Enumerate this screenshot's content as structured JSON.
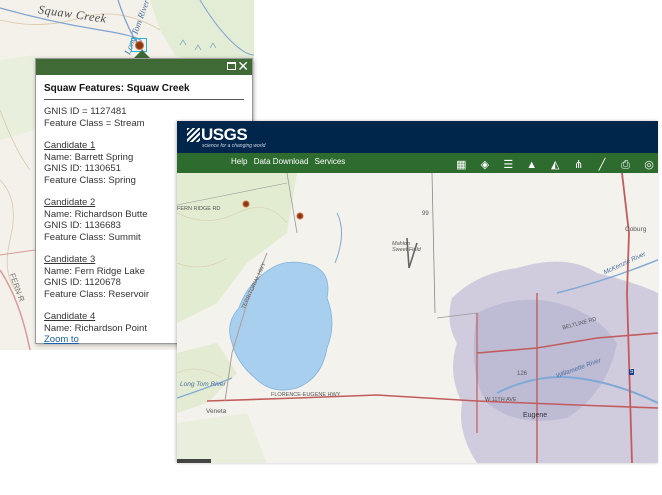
{
  "background_map": {
    "creek_label": "Squaw Creek",
    "river_label": "Long Tom River",
    "road_label": "FERN R"
  },
  "popup": {
    "title": "Squaw Features: Squaw Creek",
    "gnis_id": "GNIS ID = 1127481",
    "feature_class": "Feature Class = Stream",
    "candidates": [
      {
        "heading": "Candidate 1",
        "name": "Name:  Barrett Spring",
        "gnis": "GNIS ID: 1130651",
        "fclass": "Feature Class: Spring"
      },
      {
        "heading": "Candidate 2",
        "name": "Name:  Richardson Butte",
        "gnis": "GNIS ID: 1136683",
        "fclass": "Feature Class: Summit"
      },
      {
        "heading": "Candidate 3",
        "name": "Name:  Fern Ridge Lake",
        "gnis": "GNIS ID: 1120678",
        "fclass": "Feature Class: Reservoir"
      },
      {
        "heading": "Candidate 4",
        "name": "Name:  Richardson Point"
      }
    ],
    "zoom_link": "Zoom to",
    "maximize_icon": "window-maximize-icon",
    "close_icon": "close-icon",
    "bar_color": "#3f6a36"
  },
  "viewer": {
    "logo": "USGS",
    "tagline": "science for a changing world",
    "menu": {
      "help": "Help",
      "data_download": "Data Download",
      "services": "Services"
    },
    "tool_icons": [
      "basemap-grid-icon",
      "layers-icon",
      "legend-list-icon",
      "bookmark-icon",
      "elevation-profile-icon",
      "share-icon",
      "measure-icon",
      "print-icon",
      "overview-icon"
    ],
    "header_color": "#00264c",
    "toolbar_color": "#2e6b2e",
    "map_labels": {
      "veneta": "Veneta",
      "eugene": "Eugene",
      "coburg": "Coburg",
      "mahlon": "Mahlon Sweet Field",
      "long_tom": "Long Tom River",
      "florence": "FLORENCE-EUGENE HWY",
      "w11th": "W 11TH AVE",
      "beltline": "BELTLINE RD",
      "mckenzie": "McKenzie River",
      "willamette": "Willamette River",
      "territorial": "TERRITORIAL HWY",
      "shield_99": "99",
      "shield_126": "126",
      "shield_5": "5",
      "fern_ridge_top": "FERN RIDGE RD"
    }
  }
}
